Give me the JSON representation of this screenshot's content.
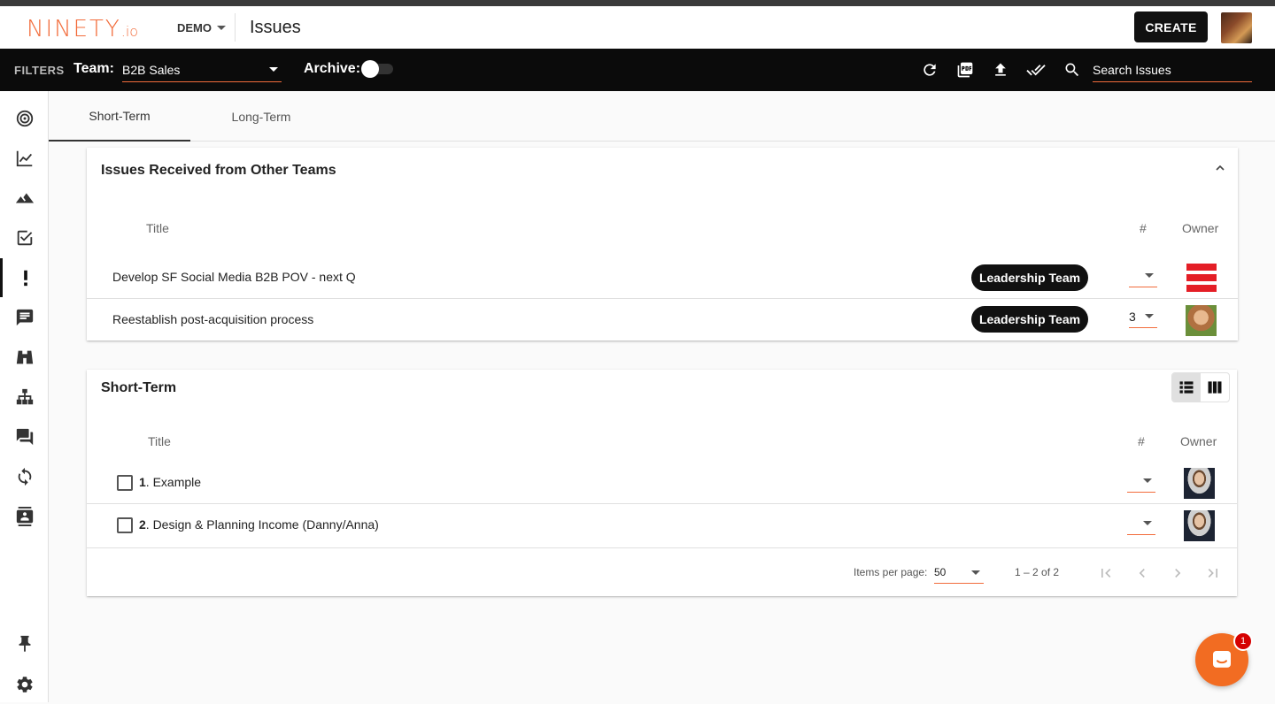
{
  "header": {
    "logo_main": "NINETY",
    "logo_suffix": ".io",
    "org_switcher": "DEMO",
    "page_title": "Issues",
    "create_label": "CREATE"
  },
  "filterbar": {
    "filters_label": "FILTERS",
    "team_label": "Team:",
    "team_value": "B2B Sales",
    "archive_label": "Archive:",
    "archive_on": false,
    "search_placeholder": "Search Issues",
    "icons": [
      "refresh-icon",
      "pdf-icon",
      "upload-icon",
      "done-all-icon",
      "search-icon"
    ]
  },
  "sidebar": {
    "items": [
      "target-icon",
      "chart-icon",
      "mountain-icon",
      "checkbox-icon",
      "exclamation-icon",
      "notes-icon",
      "binoculars-icon",
      "org-chart-icon",
      "chat-icon",
      "sync-icon",
      "contact-card-icon"
    ],
    "active": "exclamation-icon",
    "bottom": [
      "pin-icon",
      "gear-icon"
    ]
  },
  "tabs": [
    {
      "label": "Short-Term",
      "active": true
    },
    {
      "label": "Long-Term",
      "active": false
    }
  ],
  "received": {
    "title": "Issues Received from Other Teams",
    "col_title": "Title",
    "col_num": "#",
    "col_owner": "Owner",
    "rows": [
      {
        "title": "Develop SF Social Media B2B POV - next Q",
        "team": "Leadership Team",
        "num": ""
      },
      {
        "title": "Reestablish post-acquisition process",
        "team": "Leadership Team",
        "num": "3"
      }
    ]
  },
  "shortterm": {
    "title": "Short-Term",
    "col_title": "Title",
    "col_num": "#",
    "col_owner": "Owner",
    "rows": [
      {
        "index": "1",
        "title": ". Example",
        "num": ""
      },
      {
        "index": "2",
        "title": ". Design & Planning Income (Danny/Anna)",
        "num": ""
      }
    ],
    "paginator": {
      "items_per_page_label": "Items per page:",
      "items_per_page": "50",
      "range": "1 – 2 of 2"
    }
  },
  "chat": {
    "unread": "1"
  },
  "colors": {
    "accent": "#f26c3b",
    "dark": "#0b0b0b",
    "intercom": "#f26c22"
  }
}
